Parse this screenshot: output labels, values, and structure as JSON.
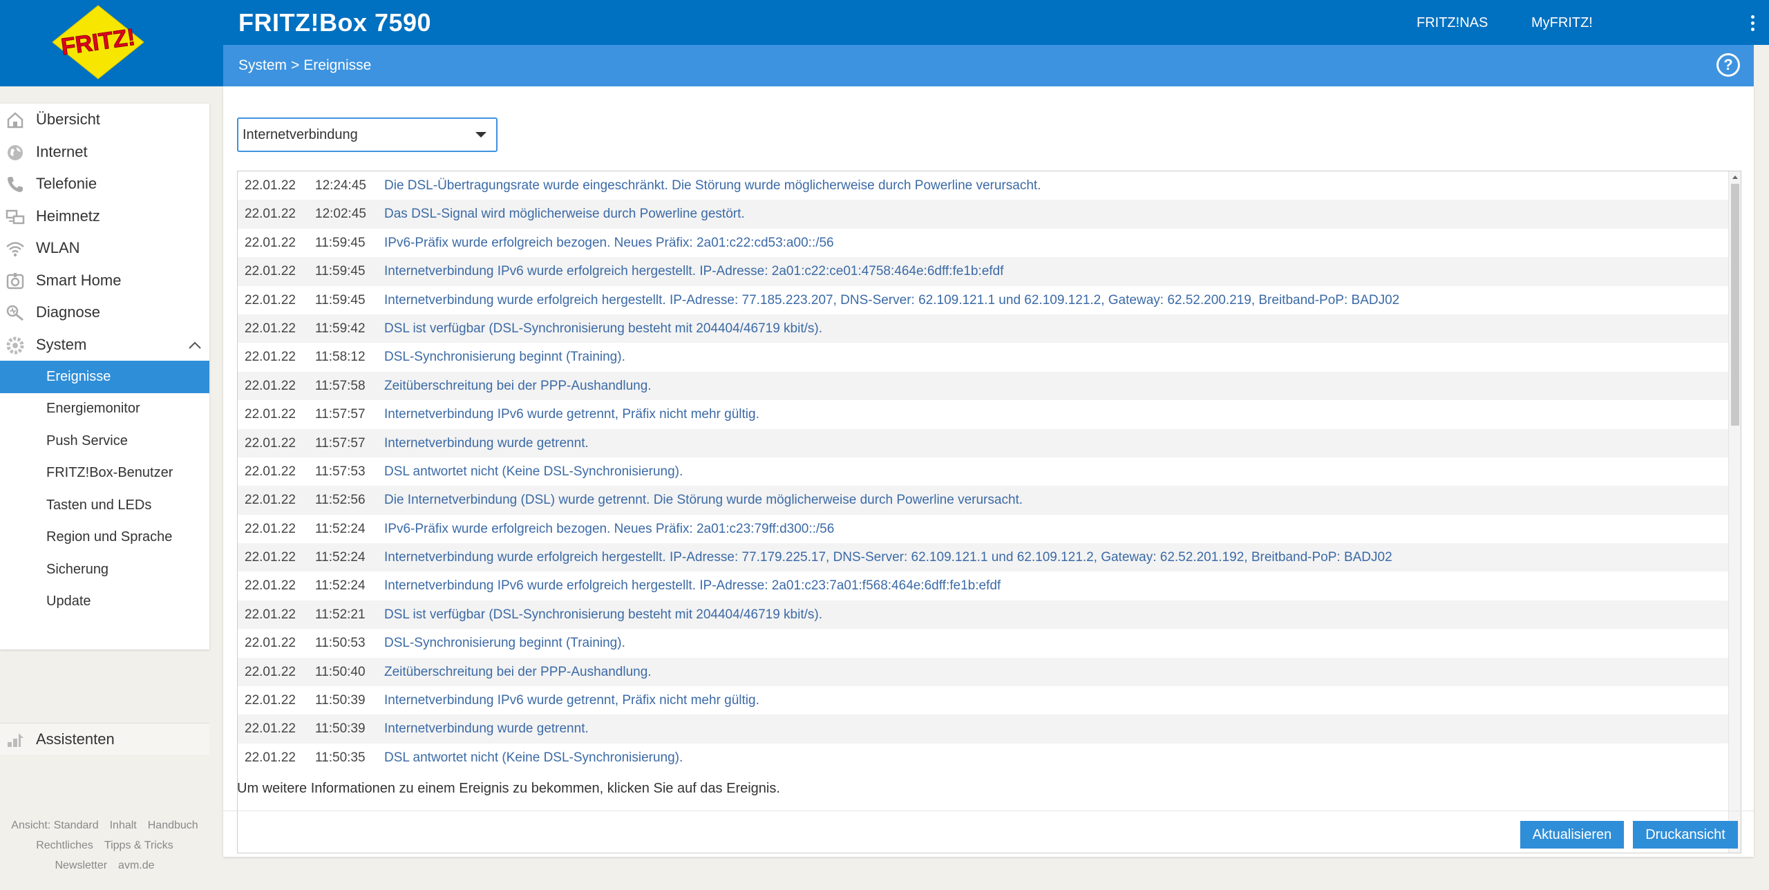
{
  "header": {
    "title": "FRITZ!Box 7590",
    "logo_text": "FRITZ!",
    "links": [
      "FRITZ!NAS",
      "MyFRITZ!"
    ],
    "accent": "#0070c0"
  },
  "breadcrumb": {
    "section": "System",
    "separator": ">",
    "page": "Ereignisse",
    "help": "?"
  },
  "sidebar": {
    "items": [
      {
        "label": "Übersicht",
        "icon": "house-icon"
      },
      {
        "label": "Internet",
        "icon": "globe-icon"
      },
      {
        "label": "Telefonie",
        "icon": "phone-icon"
      },
      {
        "label": "Heimnetz",
        "icon": "network-icon"
      },
      {
        "label": "WLAN",
        "icon": "wifi-icon"
      },
      {
        "label": "Smart Home",
        "icon": "smart-home-icon"
      },
      {
        "label": "Diagnose",
        "icon": "diagnose-icon"
      },
      {
        "label": "System",
        "icon": "gear-icon"
      }
    ],
    "system_sub": [
      "Ereignisse",
      "Energiemonitor",
      "Push Service",
      "FRITZ!Box-Benutzer",
      "Tasten und LEDs",
      "Region und Sprache",
      "Sicherung",
      "Update"
    ],
    "active_sub": "Ereignisse",
    "assist": "Assistenten"
  },
  "footer": {
    "row1": [
      "Ansicht: Standard",
      "Inhalt",
      "Handbuch"
    ],
    "row2": [
      "Rechtliches",
      "Tipps & Tricks"
    ],
    "row3": [
      "Newsletter",
      "avm.de"
    ]
  },
  "filter": {
    "selected": "Internetverbindung"
  },
  "events": [
    {
      "date": "22.01.22",
      "time": "12:24:45",
      "msg": "Die DSL-Übertragungsrate wurde eingeschränkt. Die Störung wurde möglicherweise durch Powerline verursacht."
    },
    {
      "date": "22.01.22",
      "time": "12:02:45",
      "msg": "Das DSL-Signal wird möglicherweise durch Powerline gestört."
    },
    {
      "date": "22.01.22",
      "time": "11:59:45",
      "msg": "IPv6-Präfix wurde erfolgreich bezogen. Neues Präfix: 2a01:c22:cd53:a00::/56"
    },
    {
      "date": "22.01.22",
      "time": "11:59:45",
      "msg": "Internetverbindung IPv6 wurde erfolgreich hergestellt. IP-Adresse: 2a01:c22:ce01:4758:464e:6dff:fe1b:efdf"
    },
    {
      "date": "22.01.22",
      "time": "11:59:45",
      "msg": "Internetverbindung wurde erfolgreich hergestellt. IP-Adresse: 77.185.223.207, DNS-Server: 62.109.121.1 und 62.109.121.2, Gateway: 62.52.200.219, Breitband-PoP: BADJ02"
    },
    {
      "date": "22.01.22",
      "time": "11:59:42",
      "msg": "DSL ist verfügbar (DSL-Synchronisierung besteht mit 204404/46719 kbit/s)."
    },
    {
      "date": "22.01.22",
      "time": "11:58:12",
      "msg": "DSL-Synchronisierung beginnt (Training)."
    },
    {
      "date": "22.01.22",
      "time": "11:57:58",
      "msg": "Zeitüberschreitung bei der PPP-Aushandlung."
    },
    {
      "date": "22.01.22",
      "time": "11:57:57",
      "msg": "Internetverbindung IPv6 wurde getrennt, Präfix nicht mehr gültig."
    },
    {
      "date": "22.01.22",
      "time": "11:57:57",
      "msg": "Internetverbindung wurde getrennt."
    },
    {
      "date": "22.01.22",
      "time": "11:57:53",
      "msg": "DSL antwortet nicht (Keine DSL-Synchronisierung)."
    },
    {
      "date": "22.01.22",
      "time": "11:52:56",
      "msg": "Die Internetverbindung (DSL) wurde getrennt. Die Störung wurde möglicherweise durch Powerline verursacht."
    },
    {
      "date": "22.01.22",
      "time": "11:52:24",
      "msg": "IPv6-Präfix wurde erfolgreich bezogen. Neues Präfix: 2a01:c23:79ff:d300::/56"
    },
    {
      "date": "22.01.22",
      "time": "11:52:24",
      "msg": "Internetverbindung wurde erfolgreich hergestellt. IP-Adresse: 77.179.225.17, DNS-Server: 62.109.121.1 und 62.109.121.2, Gateway: 62.52.201.192, Breitband-PoP: BADJ02"
    },
    {
      "date": "22.01.22",
      "time": "11:52:24",
      "msg": "Internetverbindung IPv6 wurde erfolgreich hergestellt. IP-Adresse: 2a01:c23:7a01:f568:464e:6dff:fe1b:efdf"
    },
    {
      "date": "22.01.22",
      "time": "11:52:21",
      "msg": "DSL ist verfügbar (DSL-Synchronisierung besteht mit 204404/46719 kbit/s)."
    },
    {
      "date": "22.01.22",
      "time": "11:50:53",
      "msg": "DSL-Synchronisierung beginnt (Training)."
    },
    {
      "date": "22.01.22",
      "time": "11:50:40",
      "msg": "Zeitüberschreitung bei der PPP-Aushandlung."
    },
    {
      "date": "22.01.22",
      "time": "11:50:39",
      "msg": "Internetverbindung IPv6 wurde getrennt, Präfix nicht mehr gültig."
    },
    {
      "date": "22.01.22",
      "time": "11:50:39",
      "msg": "Internetverbindung wurde getrennt."
    },
    {
      "date": "22.01.22",
      "time": "11:50:35",
      "msg": "DSL antwortet nicht (Keine DSL-Synchronisierung)."
    }
  ],
  "hint": "Um weitere Informationen zu einem Ereignis zu bekommen, klicken Sie auf das Ereignis.",
  "buttons": {
    "refresh": "Aktualisieren",
    "print": "Druckansicht"
  }
}
